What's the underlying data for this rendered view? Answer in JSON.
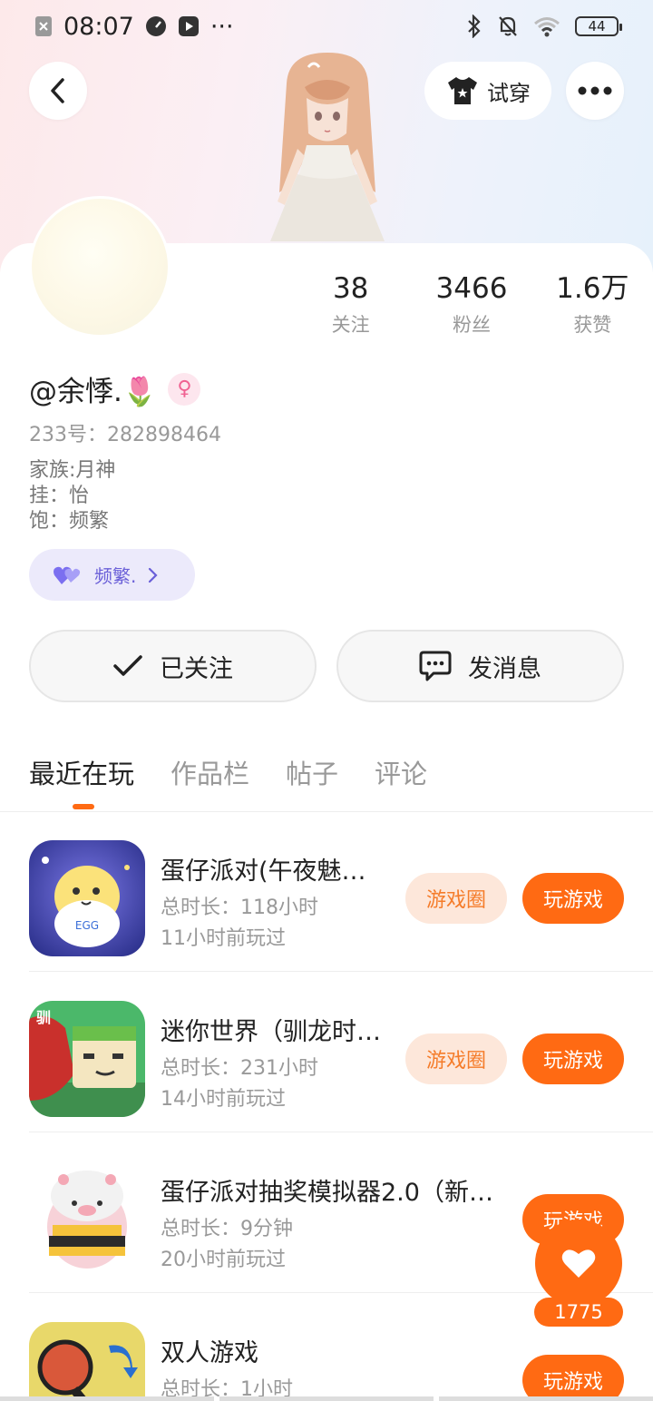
{
  "status_bar": {
    "time": "08:07",
    "more": "···",
    "battery": "44"
  },
  "header": {
    "tryon_label": "试穿"
  },
  "stats": [
    {
      "value": "38",
      "label": "关注"
    },
    {
      "value": "3466",
      "label": "粉丝"
    },
    {
      "value": "1.6万",
      "label": "获赞"
    }
  ],
  "profile": {
    "username": "@余悸.🌷",
    "uid_label": "233号：",
    "uid_value": "282898464",
    "bio_lines": [
      "家族:月神",
      "挂：怡",
      "饱：频繁"
    ],
    "family_chip": "频繁."
  },
  "actions": {
    "follow": "已关注",
    "message": "发消息"
  },
  "tabs": [
    "最近在玩",
    "作品栏",
    "帖子",
    "评论"
  ],
  "games": [
    {
      "title": "蛋仔派对(午夜魅…",
      "duration": "总时长：118小时",
      "last_played": "11小时前玩过",
      "circle_label": "游戏圈",
      "play_label": "玩游戏"
    },
    {
      "title": "迷你世界（驯龙时…",
      "duration": "总时长：231小时",
      "last_played": "14小时前玩过",
      "circle_label": "游戏圈",
      "play_label": "玩游戏"
    },
    {
      "title": "蛋仔派对抽奖模拟器2.0（新…",
      "duration": "总时长：9分钟",
      "last_played": "20小时前玩过",
      "play_label": "玩游戏"
    },
    {
      "title": "双人游戏",
      "duration": "总时长：1小时",
      "play_label": "玩游戏"
    }
  ],
  "like_fab": {
    "count": "1775"
  },
  "colors": {
    "accent": "#ff6a13",
    "chip_bg": "#eceafb",
    "chip_text": "#6a5fd8"
  }
}
